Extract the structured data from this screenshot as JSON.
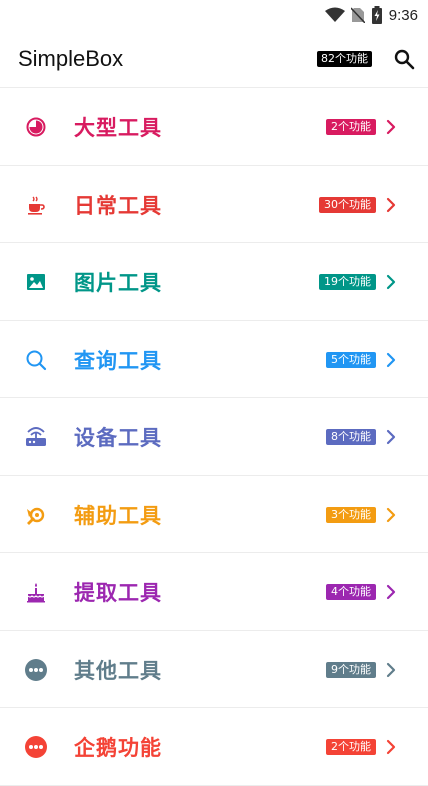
{
  "status_bar": {
    "time": "9:36"
  },
  "app_bar": {
    "title": "SimpleBox",
    "feature_count": "82个功能"
  },
  "items": [
    {
      "label": "大型工具",
      "badge": "2个功能",
      "color": "#d81b60",
      "icon": "chart-icon"
    },
    {
      "label": "日常工具",
      "badge": "30个功能",
      "color": "#e53935",
      "icon": "coffee-icon"
    },
    {
      "label": "图片工具",
      "badge": "19个功能",
      "color": "#009688",
      "icon": "image-icon"
    },
    {
      "label": "查询工具",
      "badge": "5个功能",
      "color": "#2196f3",
      "icon": "search-icon"
    },
    {
      "label": "设备工具",
      "badge": "8个功能",
      "color": "#5c6bc0",
      "icon": "router-icon"
    },
    {
      "label": "辅助工具",
      "badge": "3个功能",
      "color": "#f39c12",
      "icon": "tool-icon"
    },
    {
      "label": "提取工具",
      "badge": "4个功能",
      "color": "#9c27b0",
      "icon": "cake-icon"
    },
    {
      "label": "其他工具",
      "badge": "9个功能",
      "color": "#607d8b",
      "icon": "more-icon"
    },
    {
      "label": "企鹅功能",
      "badge": "2个功能",
      "color": "#f44336",
      "icon": "more-icon"
    }
  ]
}
